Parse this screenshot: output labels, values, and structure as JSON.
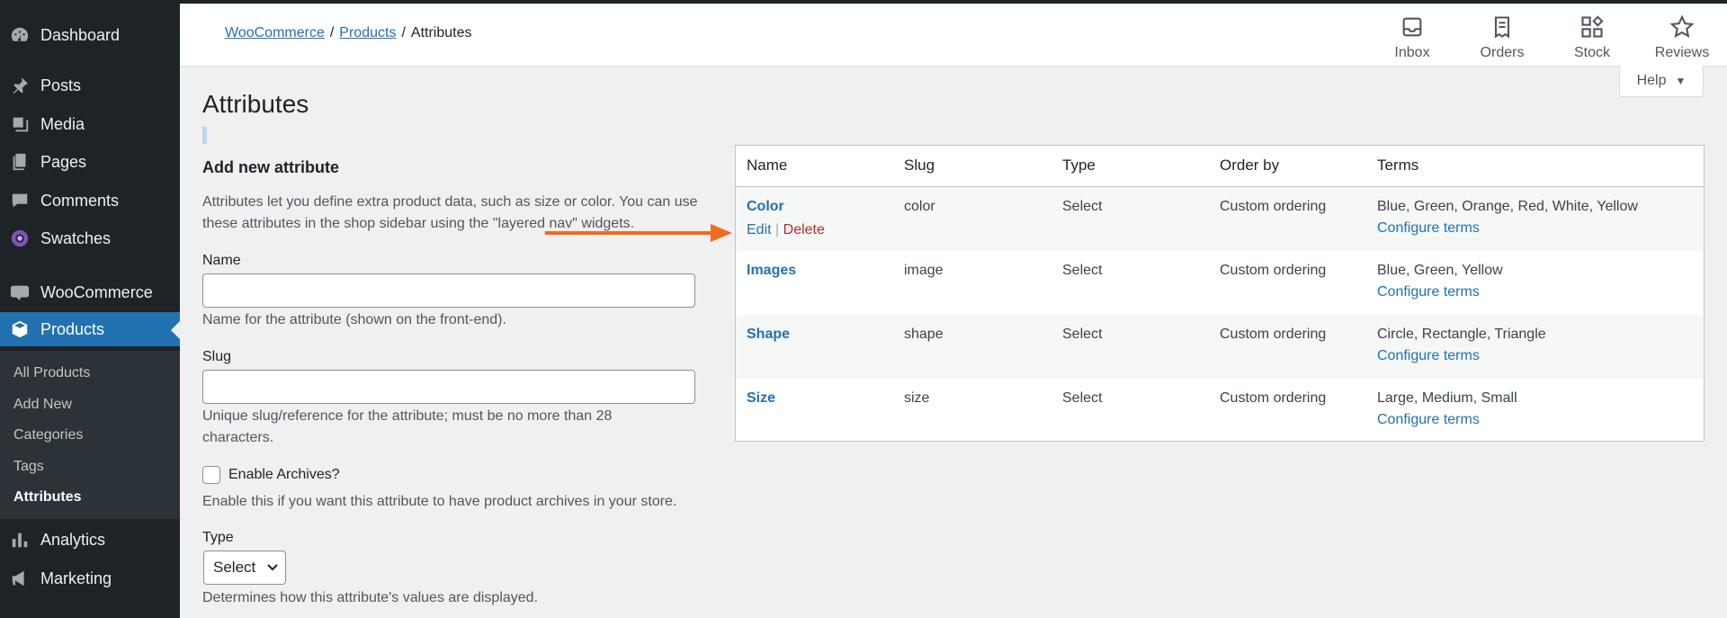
{
  "sidebar": {
    "items": [
      {
        "label": "Dashboard",
        "icon": "dashboard-icon"
      },
      {
        "label": "Posts",
        "icon": "pin-icon"
      },
      {
        "label": "Media",
        "icon": "media-icon"
      },
      {
        "label": "Pages",
        "icon": "pages-icon"
      },
      {
        "label": "Comments",
        "icon": "comment-icon"
      },
      {
        "label": "Swatches",
        "icon": "swatches-icon"
      },
      {
        "label": "WooCommerce",
        "icon": "woo-icon"
      },
      {
        "label": "Products",
        "icon": "box-icon"
      },
      {
        "label": "Analytics",
        "icon": "chart-icon"
      },
      {
        "label": "Marketing",
        "icon": "megaphone-icon"
      }
    ],
    "woo_badge": "Woo",
    "submenu": [
      "All Products",
      "Add New",
      "Categories",
      "Tags",
      "Attributes"
    ]
  },
  "breadcrumb": {
    "woocommerce": "WooCommerce",
    "products": "Products",
    "sep": "/",
    "current": "Attributes"
  },
  "header_buttons": [
    {
      "label": "Inbox",
      "icon": "inbox-icon"
    },
    {
      "label": "Orders",
      "icon": "orders-icon"
    },
    {
      "label": "Stock",
      "icon": "stock-icon"
    },
    {
      "label": "Reviews",
      "icon": "star-icon"
    }
  ],
  "help": {
    "label": "Help",
    "caret": "▼"
  },
  "page_title": "Attributes",
  "form": {
    "heading": "Add new attribute",
    "intro": "Attributes let you define extra product data, such as size or color. You can use these attributes in the shop sidebar using the \"layered nav\" widgets.",
    "name_label": "Name",
    "name_value": "",
    "name_help": "Name for the attribute (shown on the front-end).",
    "slug_label": "Slug",
    "slug_value": "",
    "slug_help": "Unique slug/reference for the attribute; must be no more than 28 characters.",
    "archives_label": "Enable Archives?",
    "archives_help": "Enable this if you want this attribute to have product archives in your store.",
    "type_label": "Type",
    "type_value": "Select",
    "type_help": "Determines how this attribute's values are displayed."
  },
  "table": {
    "headers": [
      "Name",
      "Slug",
      "Type",
      "Order by",
      "Terms"
    ],
    "rows": [
      {
        "name": "Color",
        "slug": "color",
        "type": "Select",
        "order": "Custom ordering",
        "terms": "Blue, Green, Orange, Red, White, Yellow",
        "configure": "Configure terms"
      },
      {
        "name": "Images",
        "slug": "image",
        "type": "Select",
        "order": "Custom ordering",
        "terms": "Blue, Green, Yellow",
        "configure": "Configure terms"
      },
      {
        "name": "Shape",
        "slug": "shape",
        "type": "Select",
        "order": "Custom ordering",
        "terms": "Circle, Rectangle, Triangle",
        "configure": "Configure terms"
      },
      {
        "name": "Size",
        "slug": "size",
        "type": "Select",
        "order": "Custom ordering",
        "terms": "Large, Medium, Small",
        "configure": "Configure terms"
      }
    ],
    "row_actions": {
      "edit": "Edit",
      "sep": "|",
      "delete": "Delete"
    }
  },
  "colors": {
    "accent": "#2271b1",
    "sidebar": "#1d2327",
    "danger": "#b32d2e",
    "arrow": "#f36b1c"
  }
}
